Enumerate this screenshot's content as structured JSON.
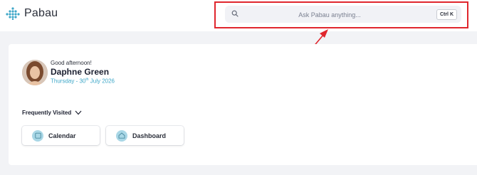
{
  "brand": {
    "name": "Pabau",
    "accent": "#3ea7c8"
  },
  "search": {
    "placeholder": "Ask Pabau anything...",
    "shortcut": "Ctrl K",
    "highlight_color": "#e0262d"
  },
  "greeting": {
    "salutation": "Good afternoon!",
    "user_name": "Daphne Green",
    "date_prefix": "Thursday - 30",
    "date_suffix": "th",
    "date_rest": " July 2026"
  },
  "frequently_visited": {
    "label": "Frequently Visited",
    "items": [
      {
        "label": "Calendar",
        "icon": "calendar-icon"
      },
      {
        "label": "Dashboard",
        "icon": "home-icon"
      }
    ]
  }
}
